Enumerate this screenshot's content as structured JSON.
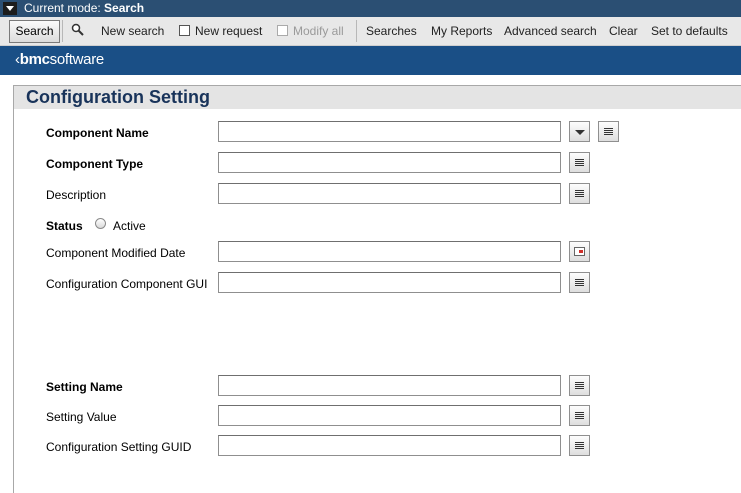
{
  "mode_bar": {
    "prefix": "Current mode:",
    "mode": "Search"
  },
  "toolbar": {
    "search": "Search",
    "new_search": "New search",
    "new_request": "New request",
    "modify_all": "Modify all",
    "searches": "Searches",
    "my_reports": "My Reports",
    "advanced_search": "Advanced search",
    "clear": "Clear",
    "set_to_defaults": "Set to defaults"
  },
  "brand": {
    "logo_bold": "bmc",
    "logo_rest": "software"
  },
  "form": {
    "title": "Configuration Setting",
    "fields": {
      "component_name": {
        "label": "Component Name",
        "value": ""
      },
      "component_type": {
        "label": "Component Type",
        "value": ""
      },
      "description": {
        "label": "Description",
        "value": ""
      },
      "status": {
        "label": "Status",
        "option": "Active",
        "selected": false
      },
      "component_modified_date": {
        "label": "Component Modified Date",
        "value": ""
      },
      "configuration_component_gui": {
        "label": "Configuration Component GUI",
        "value": ""
      },
      "setting_name": {
        "label": "Setting Name",
        "value": ""
      },
      "setting_value": {
        "label": "Setting Value",
        "value": ""
      },
      "configuration_setting_guid": {
        "label": "Configuration Setting GUID",
        "value": ""
      }
    }
  },
  "colors": {
    "mode_bar": "#2b4f73",
    "brand_bar": "#1a4f86",
    "title": "#18335a"
  },
  "icons": [
    "mode-toggle-icon",
    "search-magnifier-icon",
    "checkbox-icon",
    "modify-icon",
    "list-icon",
    "dropdown-arrow-icon",
    "calendar-icon"
  ]
}
